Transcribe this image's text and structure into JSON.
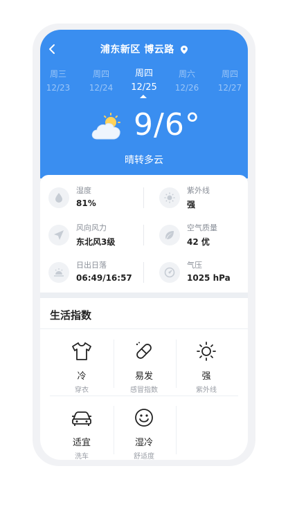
{
  "header": {
    "location": "浦东新区 博云路",
    "condition": "晴转多云",
    "temperature": "9/6°"
  },
  "days": [
    {
      "weekday": "周三",
      "date": "12/23"
    },
    {
      "weekday": "周四",
      "date": "12/24"
    },
    {
      "weekday": "周四",
      "date": "12/25",
      "active": true
    },
    {
      "weekday": "周六",
      "date": "12/26"
    },
    {
      "weekday": "周四",
      "date": "12/27"
    }
  ],
  "details": [
    {
      "label": "湿度",
      "value": "81%"
    },
    {
      "label": "紫外线",
      "value": "强"
    },
    {
      "label": "风向风力",
      "value": "东北风3级"
    },
    {
      "label": "空气质量",
      "value": "42 优"
    },
    {
      "label": "日出日落",
      "value": "06:49/16:57"
    },
    {
      "label": "气压",
      "value": "1025 hPa"
    }
  ],
  "life": {
    "title": "生活指数",
    "items": [
      {
        "value": "冷",
        "label": "穿衣",
        "icon": "tshirt-icon"
      },
      {
        "value": "易发",
        "label": "感冒指数",
        "icon": "pill-icon"
      },
      {
        "value": "强",
        "label": "紫外线",
        "icon": "sun-icon"
      },
      {
        "value": "适宜",
        "label": "洗车",
        "icon": "car-icon"
      },
      {
        "value": "湿冷",
        "label": "舒适度",
        "icon": "smiley-icon"
      }
    ]
  },
  "colors": {
    "accent": "#3a8ef0",
    "bg": "#eceff3"
  }
}
